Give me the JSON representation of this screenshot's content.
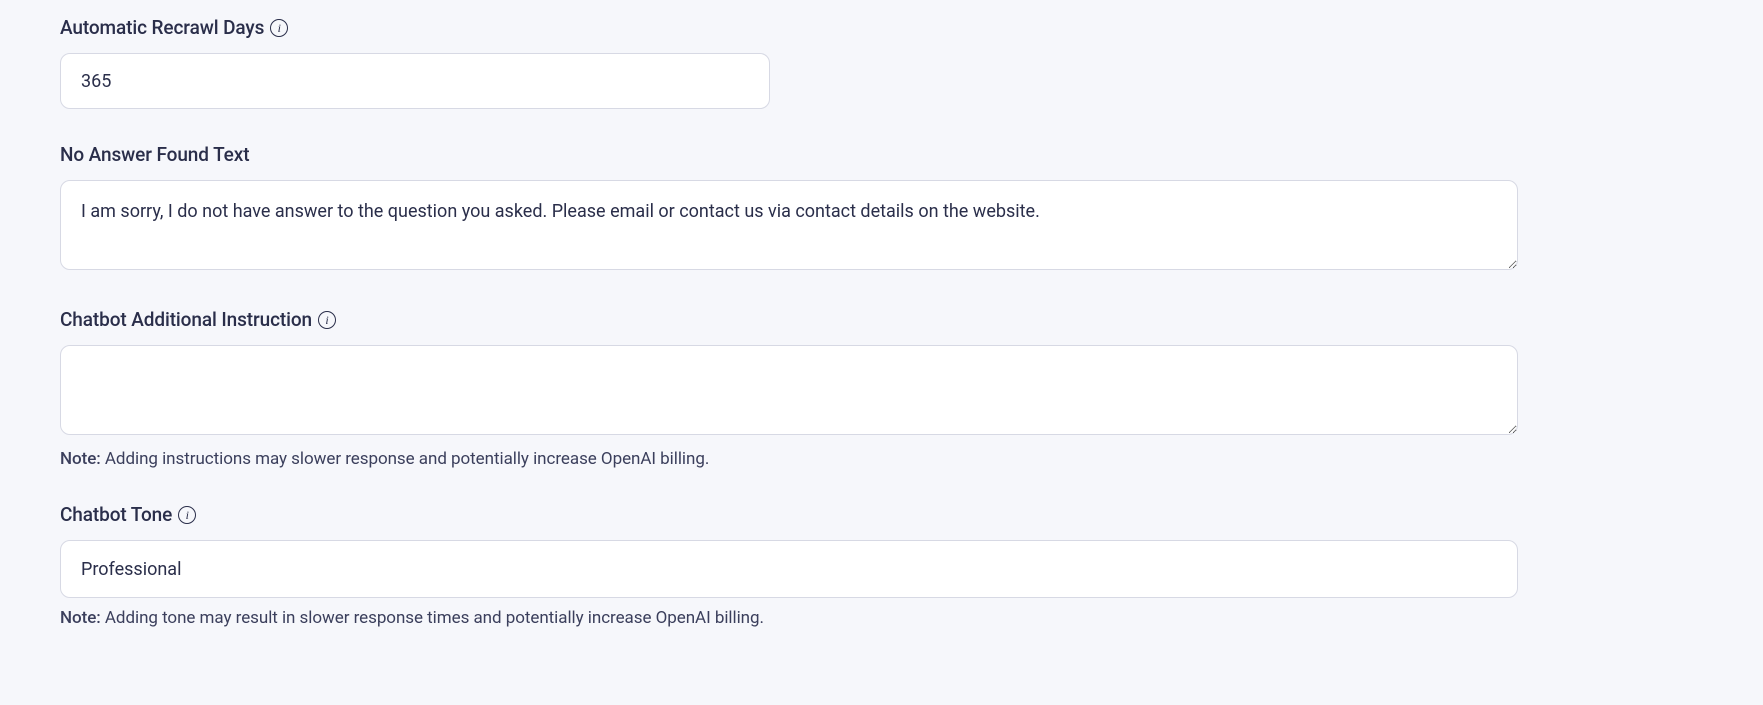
{
  "fields": {
    "recrawl": {
      "label": "Automatic Recrawl Days",
      "value": "365"
    },
    "noAnswer": {
      "label": "No Answer Found Text",
      "value": "I am sorry, I do not have answer to the question you asked. Please email or contact us via contact details on the website."
    },
    "additionalInstruction": {
      "label": "Chatbot Additional Instruction",
      "value": "",
      "notePrefix": "Note:",
      "noteText": " Adding instructions may slower response and potentially increase OpenAI billing."
    },
    "tone": {
      "label": "Chatbot Tone",
      "value": "Professional",
      "notePrefix": "Note:",
      "noteText": " Adding tone may result in slower response times and potentially increase OpenAI billing."
    }
  },
  "icons": {
    "info": "i"
  }
}
